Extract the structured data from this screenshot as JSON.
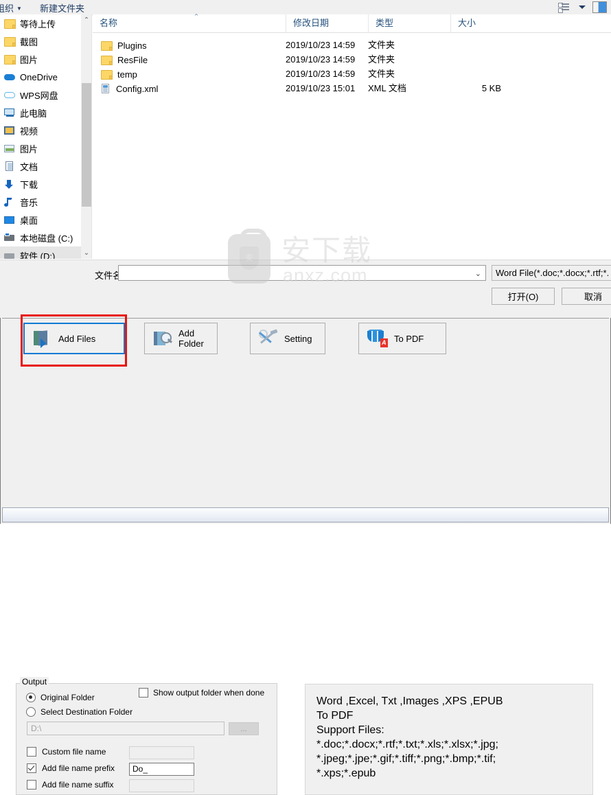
{
  "dialog": {
    "toolbar": {
      "organize": "组织",
      "new_folder": "新建文件夹",
      "view_mode_icon": "view-mode-icon",
      "preview_pane_icon": "preview-pane-icon"
    },
    "nav_items": [
      {
        "label": "等待上传",
        "icon": "folder-icon",
        "selected": false
      },
      {
        "label": "截图",
        "icon": "folder-icon",
        "selected": false
      },
      {
        "label": "图片",
        "icon": "folder-icon",
        "selected": false
      },
      {
        "label": "OneDrive",
        "icon": "onedrive-icon",
        "selected": false
      },
      {
        "label": "WPS网盘",
        "icon": "wps-cloud-icon",
        "selected": false
      },
      {
        "label": "此电脑",
        "icon": "this-pc-icon",
        "selected": false
      },
      {
        "label": "视频",
        "icon": "videos-icon",
        "selected": false
      },
      {
        "label": "图片",
        "icon": "pictures-icon",
        "selected": false
      },
      {
        "label": "文档",
        "icon": "documents-icon",
        "selected": false
      },
      {
        "label": "下载",
        "icon": "downloads-icon",
        "selected": false
      },
      {
        "label": "音乐",
        "icon": "music-icon",
        "selected": false
      },
      {
        "label": "桌面",
        "icon": "desktop-icon",
        "selected": false
      },
      {
        "label": "本地磁盘 (C:)",
        "icon": "local-disk-icon",
        "selected": false
      },
      {
        "label": "软件 (D:)",
        "icon": "disk-icon",
        "selected": true
      }
    ],
    "columns": [
      {
        "label": "名称"
      },
      {
        "label": "修改日期"
      },
      {
        "label": "类型"
      },
      {
        "label": "大小"
      }
    ],
    "files": [
      {
        "name": "Plugins",
        "icon": "folder-icon",
        "date": "2019/10/23 14:59",
        "type": "文件夹",
        "size": ""
      },
      {
        "name": "ResFile",
        "icon": "folder-icon",
        "date": "2019/10/23 14:59",
        "type": "文件夹",
        "size": ""
      },
      {
        "name": "temp",
        "icon": "folder-icon",
        "date": "2019/10/23 14:59",
        "type": "文件夹",
        "size": ""
      },
      {
        "name": "Config.xml",
        "icon": "xml-file-icon",
        "date": "2019/10/23 15:01",
        "type": "XML 文档",
        "size": "5 KB"
      }
    ],
    "filename": {
      "label": "文件名(N):",
      "value": "",
      "placeholder": ""
    },
    "filetype": {
      "value": "Word File(*.doc;*.docx;*.rtf;*."
    },
    "buttons": {
      "open": "打开(O)",
      "cancel": "取消"
    }
  },
  "app": {
    "toolbar": [
      {
        "label": "Add Files",
        "icon": "add-files-icon",
        "focused": true
      },
      {
        "label": "Add Folder",
        "icon": "add-folder-icon",
        "focused": false
      },
      {
        "label": "Setting",
        "icon": "setting-icon",
        "focused": false
      },
      {
        "label": "To PDF",
        "icon": "to-pdf-icon",
        "focused": false
      }
    ],
    "output": {
      "title": "Output",
      "original_folder": "Original Folder",
      "select_destination_folder": "Select Destination Folder",
      "show_output_folder": "Show output folder when done",
      "destination_path": "D:\\",
      "browse_label": "...",
      "custom_file_name": "Custom file name",
      "custom_file_name_value": "",
      "add_prefix": "Add file name prefix",
      "add_prefix_value": "Do_",
      "add_suffix": "Add file name suffix",
      "add_suffix_value": ""
    },
    "info": {
      "line1": "Word ,Excel, Txt ,Images ,XPS ,EPUB",
      "line2": "To PDF",
      "line3": "Support Files:",
      "line4": "*.doc;*.docx;*.rtf;*.txt;*.xls;*.xlsx;*.jpg;",
      "line5": "*.jpeg;*.jpe;*.gif;*.tiff;*.png;*.bmp;*.tif;",
      "line6": "*.xps;*.epub"
    }
  },
  "watermark": {
    "cn": "安下载",
    "url": "anxz.com",
    "shield_char": "安"
  },
  "colors": {
    "accent": "#0d7ad4",
    "annotation": "#e8120c",
    "nav_text": "#1f3c63",
    "column_header": "#26527d"
  }
}
